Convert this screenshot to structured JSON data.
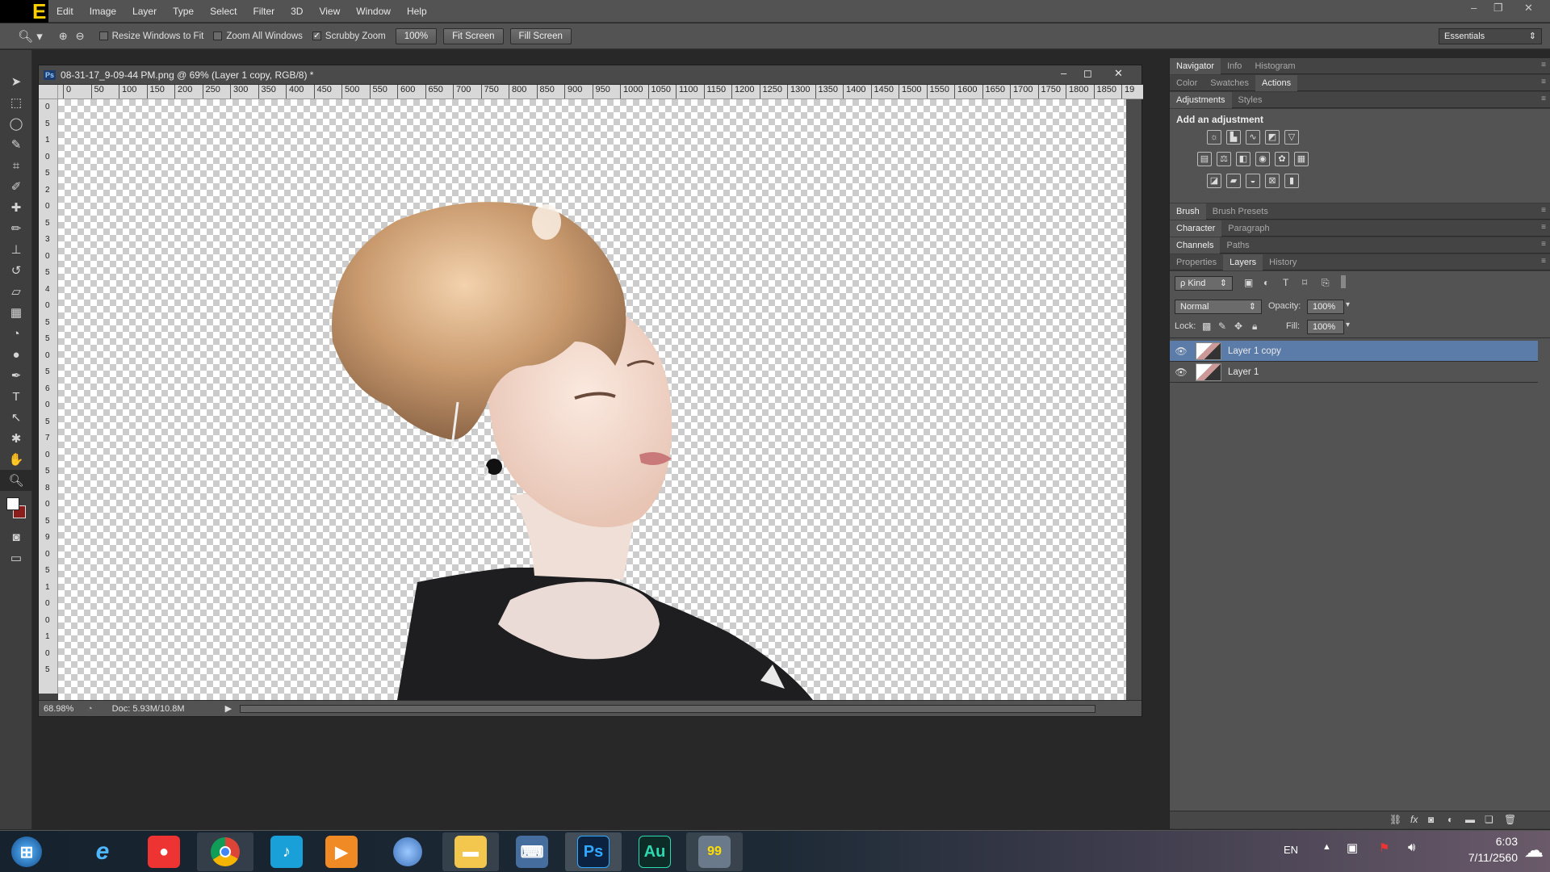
{
  "app": {
    "logo_text": "E"
  },
  "menu": [
    "Edit",
    "Image",
    "Layer",
    "Type",
    "Select",
    "Filter",
    "3D",
    "View",
    "Window",
    "Help"
  ],
  "window_controls": {
    "minimize": "–",
    "restore": "❐",
    "close": "✕"
  },
  "options": {
    "zoom_tool_icon": "zoom-icon",
    "resize_windows": {
      "label": "Resize Windows to Fit",
      "checked": false
    },
    "zoom_all": {
      "label": "Zoom All Windows",
      "checked": false
    },
    "scrubby_zoom": {
      "label": "Scrubby Zoom",
      "checked": true
    },
    "btn_100": "100%",
    "btn_fit": "Fit Screen",
    "btn_fill": "Fill Screen",
    "workspace": "Essentials"
  },
  "document": {
    "title": "08-31-17_9-09-44 PM.png @ 69% (Layer 1 copy, RGB/8) *",
    "ps_badge": "Ps",
    "ruler_h": [
      "0",
      "50",
      "100",
      "150",
      "200",
      "250",
      "300",
      "350",
      "400",
      "450",
      "500",
      "550",
      "600",
      "650",
      "700",
      "750",
      "800",
      "850",
      "900",
      "950",
      "1000",
      "1050",
      "1100",
      "1150",
      "1200",
      "1250",
      "1300",
      "1350",
      "1400",
      "1450",
      "1500",
      "1550",
      "1600",
      "1650",
      "1700",
      "1750",
      "1800",
      "1850",
      "19"
    ],
    "ruler_v": [
      "0",
      "5",
      "1",
      "0",
      "5",
      "2",
      "0",
      "5",
      "3",
      "0",
      "5",
      "4",
      "0",
      "5",
      "5",
      "0",
      "5",
      "6",
      "0",
      "5",
      "7",
      "0",
      "5",
      "8",
      "0",
      "5",
      "9",
      "0",
      "5",
      "1",
      "0",
      "0",
      "1",
      "0",
      "5"
    ],
    "zoom": "68.98%",
    "doc_size": "Doc: 5.93M/10.8M"
  },
  "panels": {
    "row1": [
      "Navigator",
      "Info",
      "Histogram"
    ],
    "row2": [
      "Color",
      "Swatches",
      "Actions"
    ],
    "row3": [
      "Adjustments",
      "Styles"
    ],
    "add_adjustment": "Add an adjustment",
    "row_brush": [
      "Brush",
      "Brush Presets"
    ],
    "row_char": [
      "Character",
      "Paragraph"
    ],
    "row_chan": [
      "Channels",
      "Paths"
    ],
    "row_layers": [
      "Properties",
      "Layers",
      "History"
    ],
    "layers": {
      "kind": "ρ Kind",
      "blend_mode": "Normal",
      "opacity_label": "Opacity:",
      "opacity": "100%",
      "lock_label": "Lock:",
      "fill_label": "Fill:",
      "fill": "100%",
      "items": [
        {
          "name": "Layer 1 copy",
          "selected": true
        },
        {
          "name": "Layer 1",
          "selected": false
        }
      ]
    }
  },
  "taskbar": {
    "apps": [
      "Start",
      "Internet Explorer",
      "Red App",
      "Chrome",
      "Music App",
      "Media Player",
      "Chromium",
      "File Explorer",
      "Keyboard",
      "Photoshop",
      "Audition",
      "Tool 99"
    ],
    "ps_label": "Ps",
    "au_label": "Au",
    "lang": "EN",
    "time": "6:03",
    "date": "7/11/2560"
  },
  "colors": {
    "selected_layer": "#5b7ba8",
    "panel_bg": "#3c3c3c",
    "foreground": "#ffffff",
    "background": "#8b1d1d"
  }
}
